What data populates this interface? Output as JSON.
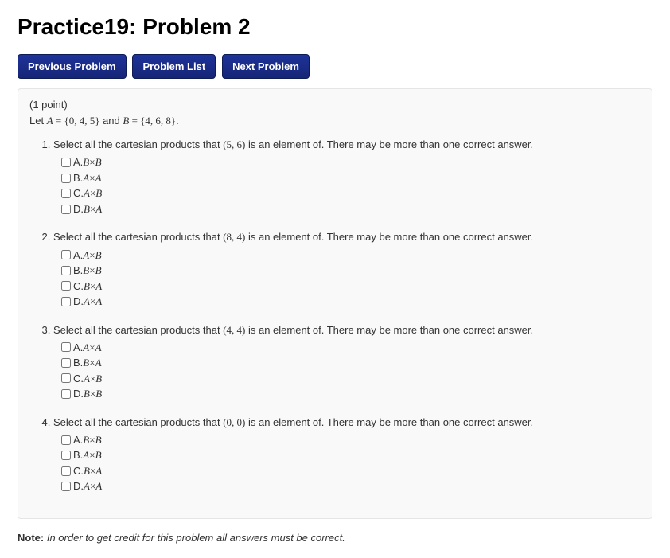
{
  "title": "Practice19: Problem 2",
  "nav": {
    "prev": "Previous Problem",
    "list": "Problem List",
    "next": "Next Problem"
  },
  "points": "(1 point)",
  "intro_prefix": "Let ",
  "intro_A_label": "A",
  "intro_eq1": " = ",
  "intro_A_set": "{0, 4, 5}",
  "intro_and": " and ",
  "intro_B_label": "B",
  "intro_eq2": " = ",
  "intro_B_set": "{4, 6, 8}",
  "intro_period": ".",
  "q_prefix": "Select all the cartesian products that ",
  "q_suffix": " is an element of. There may be more than one correct answer.",
  "questions": [
    {
      "tuple": "(5, 6)",
      "options": [
        {
          "letter": "A.",
          "left": "B",
          "right": "B"
        },
        {
          "letter": "B.",
          "left": "A",
          "right": "A"
        },
        {
          "letter": "C.",
          "left": "A",
          "right": "B"
        },
        {
          "letter": "D.",
          "left": "B",
          "right": "A"
        }
      ]
    },
    {
      "tuple": "(8, 4)",
      "options": [
        {
          "letter": "A.",
          "left": "A",
          "right": "B"
        },
        {
          "letter": "B.",
          "left": "B",
          "right": "B"
        },
        {
          "letter": "C.",
          "left": "B",
          "right": "A"
        },
        {
          "letter": "D.",
          "left": "A",
          "right": "A"
        }
      ]
    },
    {
      "tuple": "(4, 4)",
      "options": [
        {
          "letter": "A.",
          "left": "A",
          "right": "A"
        },
        {
          "letter": "B.",
          "left": "B",
          "right": "A"
        },
        {
          "letter": "C.",
          "left": "A",
          "right": "B"
        },
        {
          "letter": "D.",
          "left": "B",
          "right": "B"
        }
      ]
    },
    {
      "tuple": "(0, 0)",
      "options": [
        {
          "letter": "A.",
          "left": "B",
          "right": "B"
        },
        {
          "letter": "B.",
          "left": "A",
          "right": "B"
        },
        {
          "letter": "C.",
          "left": "B",
          "right": "A"
        },
        {
          "letter": "D.",
          "left": "A",
          "right": "A"
        }
      ]
    }
  ],
  "note_label": "Note:",
  "note_text": "In order to get credit for this problem all answers must be correct.",
  "times_sym": "×"
}
